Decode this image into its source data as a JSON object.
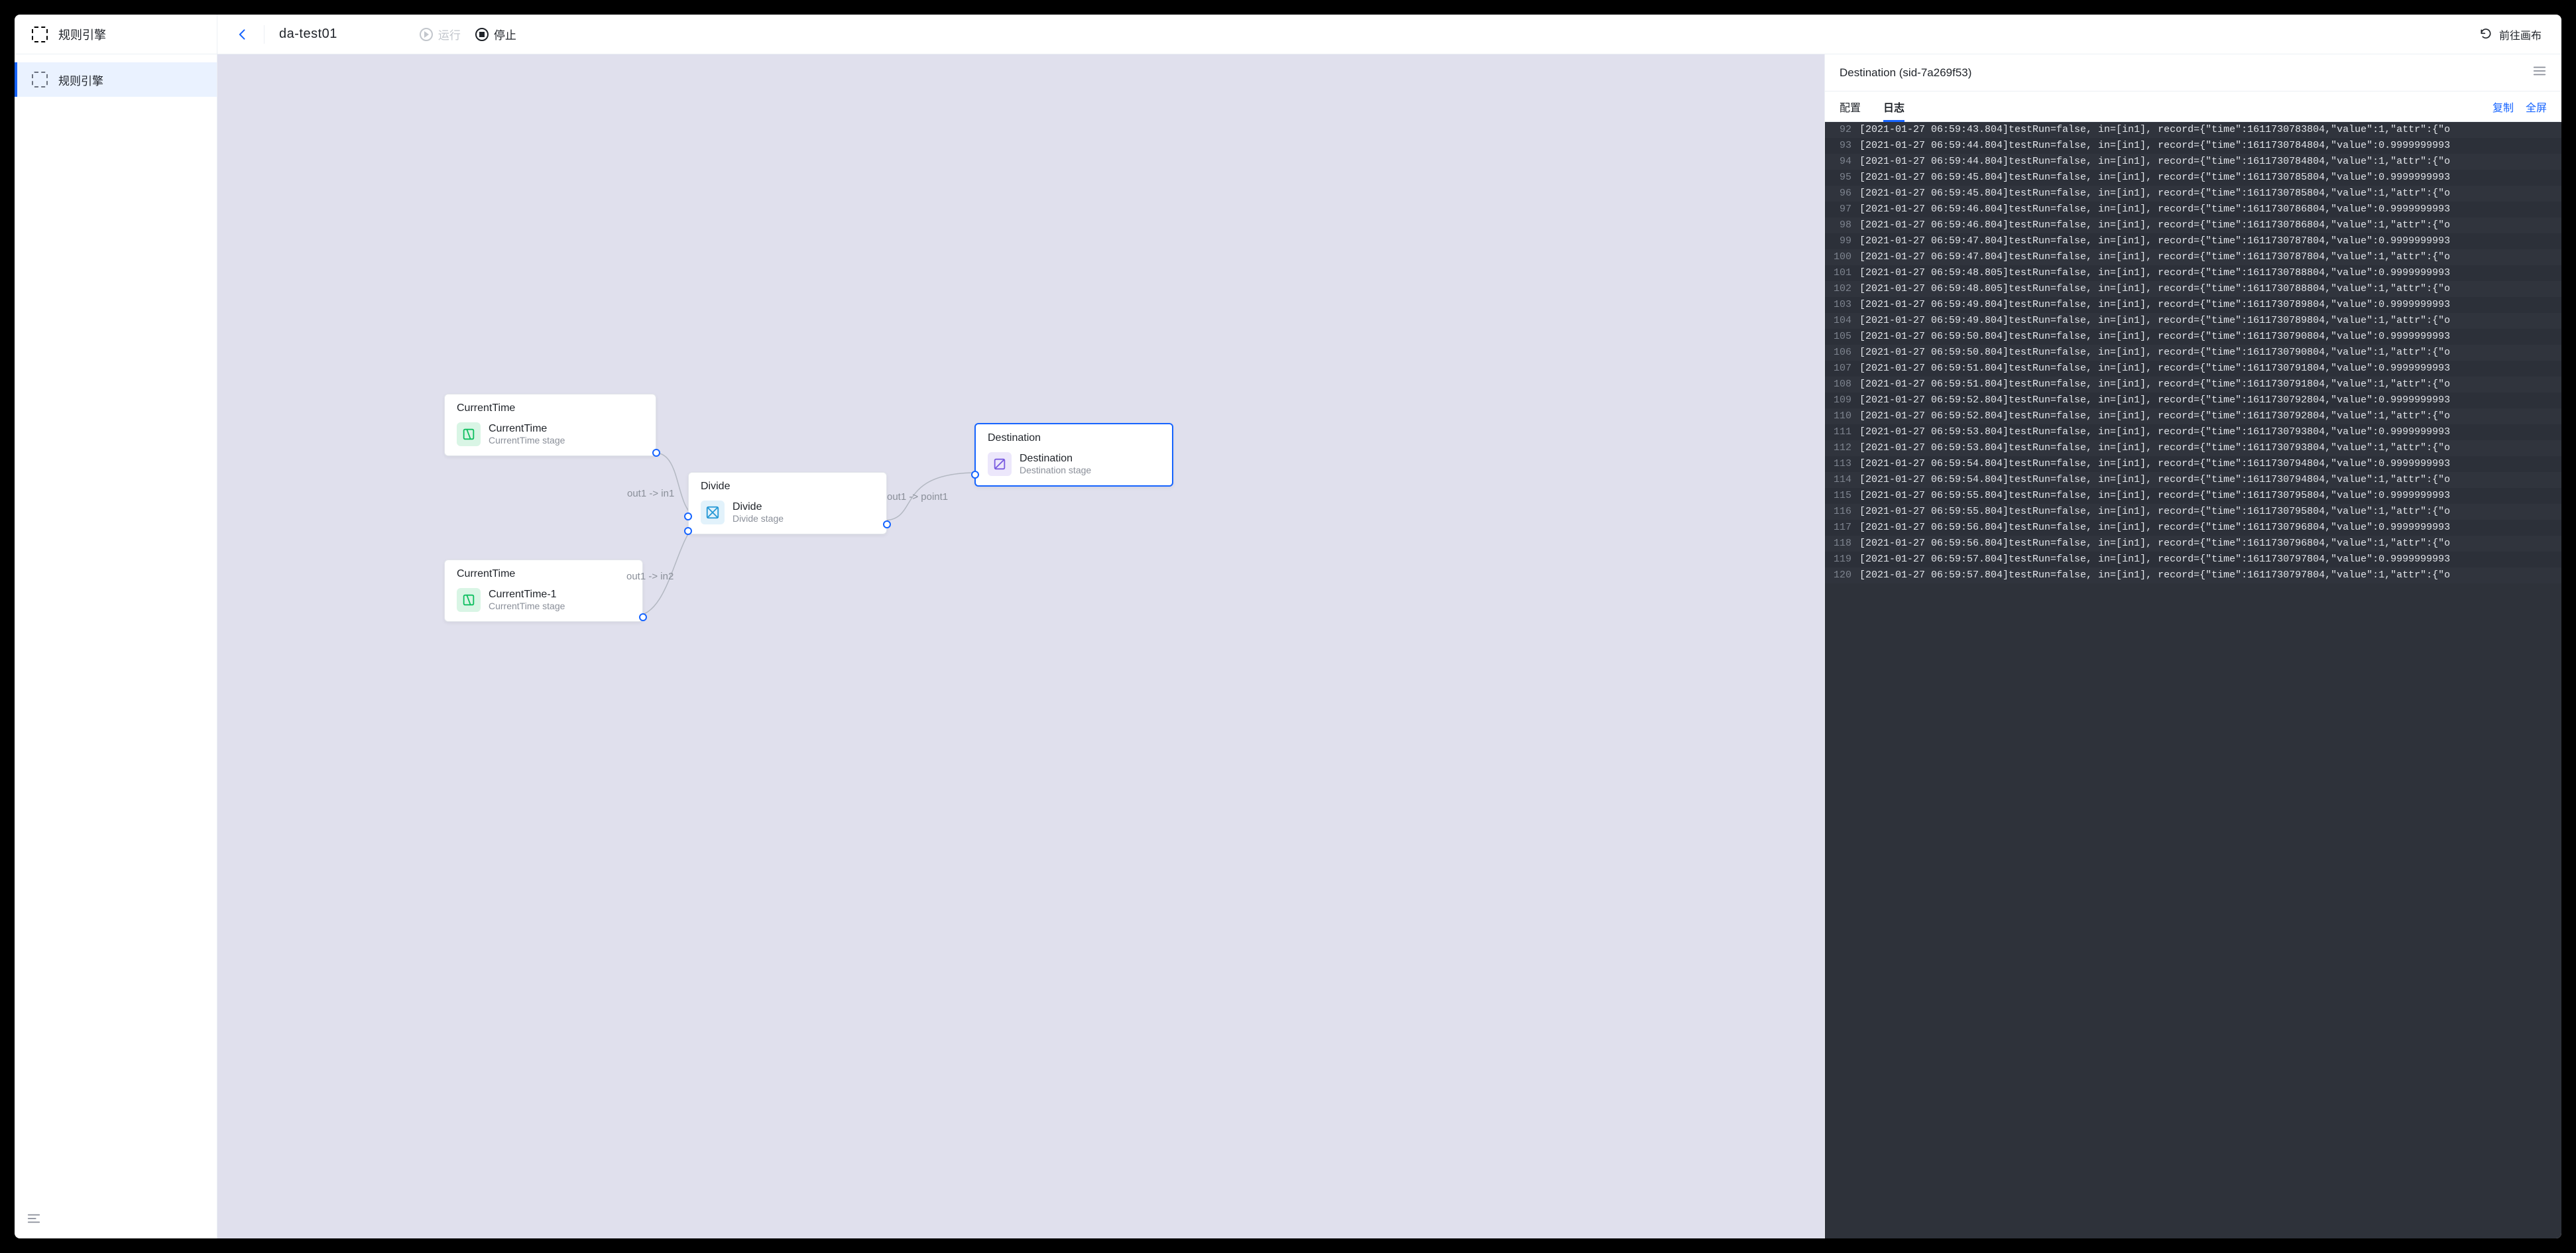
{
  "app": {
    "title": "规则引擎"
  },
  "header": {
    "page_name": "da-test01",
    "run_label": "运行",
    "stop_label": "停止",
    "goto_canvas": "前往画布"
  },
  "sidebar": {
    "items": [
      {
        "label": "规则引擎",
        "active": true
      }
    ]
  },
  "canvas": {
    "nodes": {
      "ct0": {
        "title": "CurrentTime",
        "name": "CurrentTime",
        "sub": "CurrentTime stage",
        "icon": "time-green"
      },
      "ct1": {
        "title": "CurrentTime",
        "name": "CurrentTime-1",
        "sub": "CurrentTime stage",
        "icon": "time-green"
      },
      "div": {
        "title": "Divide",
        "name": "Divide",
        "sub": "Divide stage",
        "icon": "divide-blue"
      },
      "dst": {
        "title": "Destination",
        "name": "Destination",
        "sub": "Destination stage",
        "icon": "dest-purple"
      }
    },
    "edge_labels": {
      "e0": "out1  ->  in1",
      "e1": "out1  ->  in2",
      "e2": "out1  ->  point1"
    }
  },
  "inspector": {
    "title": "Destination (sid-7a269f53)",
    "tabs": {
      "config": "配置",
      "log": "日志"
    },
    "actions": {
      "copy": "复制",
      "fullscreen": "全屏"
    },
    "log": [
      {
        "n": 92,
        "t": "[2021-01-27 06:59:43.804]testRun=false, in=[in1], record={\"time\":1611730783804,\"value\":1,\"attr\":{\"o"
      },
      {
        "n": 93,
        "t": "[2021-01-27 06:59:44.804]testRun=false, in=[in1], record={\"time\":1611730784804,\"value\":0.9999999993"
      },
      {
        "n": 94,
        "t": "[2021-01-27 06:59:44.804]testRun=false, in=[in1], record={\"time\":1611730784804,\"value\":1,\"attr\":{\"o"
      },
      {
        "n": 95,
        "t": "[2021-01-27 06:59:45.804]testRun=false, in=[in1], record={\"time\":1611730785804,\"value\":0.9999999993"
      },
      {
        "n": 96,
        "t": "[2021-01-27 06:59:45.804]testRun=false, in=[in1], record={\"time\":1611730785804,\"value\":1,\"attr\":{\"o"
      },
      {
        "n": 97,
        "t": "[2021-01-27 06:59:46.804]testRun=false, in=[in1], record={\"time\":1611730786804,\"value\":0.9999999993"
      },
      {
        "n": 98,
        "t": "[2021-01-27 06:59:46.804]testRun=false, in=[in1], record={\"time\":1611730786804,\"value\":1,\"attr\":{\"o"
      },
      {
        "n": 99,
        "t": "[2021-01-27 06:59:47.804]testRun=false, in=[in1], record={\"time\":1611730787804,\"value\":0.9999999993"
      },
      {
        "n": 100,
        "t": "[2021-01-27 06:59:47.804]testRun=false, in=[in1], record={\"time\":1611730787804,\"value\":1,\"attr\":{\"o"
      },
      {
        "n": 101,
        "t": "[2021-01-27 06:59:48.805]testRun=false, in=[in1], record={\"time\":1611730788804,\"value\":0.9999999993"
      },
      {
        "n": 102,
        "t": "[2021-01-27 06:59:48.805]testRun=false, in=[in1], record={\"time\":1611730788804,\"value\":1,\"attr\":{\"o"
      },
      {
        "n": 103,
        "t": "[2021-01-27 06:59:49.804]testRun=false, in=[in1], record={\"time\":1611730789804,\"value\":0.9999999993"
      },
      {
        "n": 104,
        "t": "[2021-01-27 06:59:49.804]testRun=false, in=[in1], record={\"time\":1611730789804,\"value\":1,\"attr\":{\"o"
      },
      {
        "n": 105,
        "t": "[2021-01-27 06:59:50.804]testRun=false, in=[in1], record={\"time\":1611730790804,\"value\":0.9999999993"
      },
      {
        "n": 106,
        "t": "[2021-01-27 06:59:50.804]testRun=false, in=[in1], record={\"time\":1611730790804,\"value\":1,\"attr\":{\"o"
      },
      {
        "n": 107,
        "t": "[2021-01-27 06:59:51.804]testRun=false, in=[in1], record={\"time\":1611730791804,\"value\":0.9999999993"
      },
      {
        "n": 108,
        "t": "[2021-01-27 06:59:51.804]testRun=false, in=[in1], record={\"time\":1611730791804,\"value\":1,\"attr\":{\"o"
      },
      {
        "n": 109,
        "t": "[2021-01-27 06:59:52.804]testRun=false, in=[in1], record={\"time\":1611730792804,\"value\":0.9999999993"
      },
      {
        "n": 110,
        "t": "[2021-01-27 06:59:52.804]testRun=false, in=[in1], record={\"time\":1611730792804,\"value\":1,\"attr\":{\"o"
      },
      {
        "n": 111,
        "t": "[2021-01-27 06:59:53.804]testRun=false, in=[in1], record={\"time\":1611730793804,\"value\":0.9999999993"
      },
      {
        "n": 112,
        "t": "[2021-01-27 06:59:53.804]testRun=false, in=[in1], record={\"time\":1611730793804,\"value\":1,\"attr\":{\"o"
      },
      {
        "n": 113,
        "t": "[2021-01-27 06:59:54.804]testRun=false, in=[in1], record={\"time\":1611730794804,\"value\":0.9999999993"
      },
      {
        "n": 114,
        "t": "[2021-01-27 06:59:54.804]testRun=false, in=[in1], record={\"time\":1611730794804,\"value\":1,\"attr\":{\"o"
      },
      {
        "n": 115,
        "t": "[2021-01-27 06:59:55.804]testRun=false, in=[in1], record={\"time\":1611730795804,\"value\":0.9999999993"
      },
      {
        "n": 116,
        "t": "[2021-01-27 06:59:55.804]testRun=false, in=[in1], record={\"time\":1611730795804,\"value\":1,\"attr\":{\"o"
      },
      {
        "n": 117,
        "t": "[2021-01-27 06:59:56.804]testRun=false, in=[in1], record={\"time\":1611730796804,\"value\":0.9999999993"
      },
      {
        "n": 118,
        "t": "[2021-01-27 06:59:56.804]testRun=false, in=[in1], record={\"time\":1611730796804,\"value\":1,\"attr\":{\"o"
      },
      {
        "n": 119,
        "t": "[2021-01-27 06:59:57.804]testRun=false, in=[in1], record={\"time\":1611730797804,\"value\":0.9999999993"
      },
      {
        "n": 120,
        "t": "[2021-01-27 06:59:57.804]testRun=false, in=[in1], record={\"time\":1611730797804,\"value\":1,\"attr\":{\"o"
      }
    ]
  }
}
